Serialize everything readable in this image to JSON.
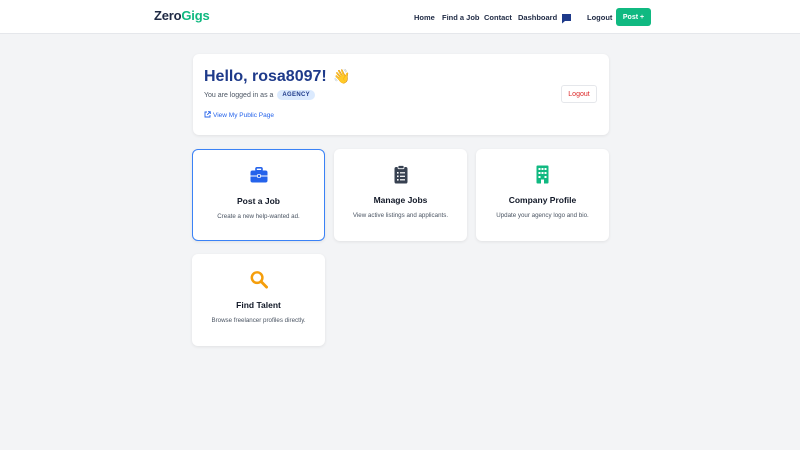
{
  "brand": {
    "part1": "Zero",
    "part2": "Gigs",
    "accent": "#10b981"
  },
  "nav": {
    "home": "Home",
    "find_job": "Find a Job",
    "contact": "Contact",
    "dashboard": "Dashboard",
    "chat_icon": "chat-icon",
    "logout": "Logout",
    "post": "Post +"
  },
  "greeting": {
    "title": "Hello, rosa8097!",
    "emoji": "👋",
    "logged_as": "You are logged in as a",
    "role": "AGENCY",
    "public_link": "View My Public Page",
    "logout": "Logout"
  },
  "cards": [
    {
      "icon": "briefcase-icon",
      "icon_color": "#2563eb",
      "title": "Post a Job",
      "desc": "Create a new help-wanted ad."
    },
    {
      "icon": "clipboard-list-icon",
      "icon_color": "#374151",
      "title": "Manage Jobs",
      "desc": "View active listings and applicants."
    },
    {
      "icon": "building-icon",
      "icon_color": "#10b981",
      "title": "Company Profile",
      "desc": "Update your agency logo and bio."
    },
    {
      "icon": "search-icon",
      "icon_color": "#f59e0b",
      "title": "Find Talent",
      "desc": "Browse freelancer profiles directly."
    }
  ]
}
